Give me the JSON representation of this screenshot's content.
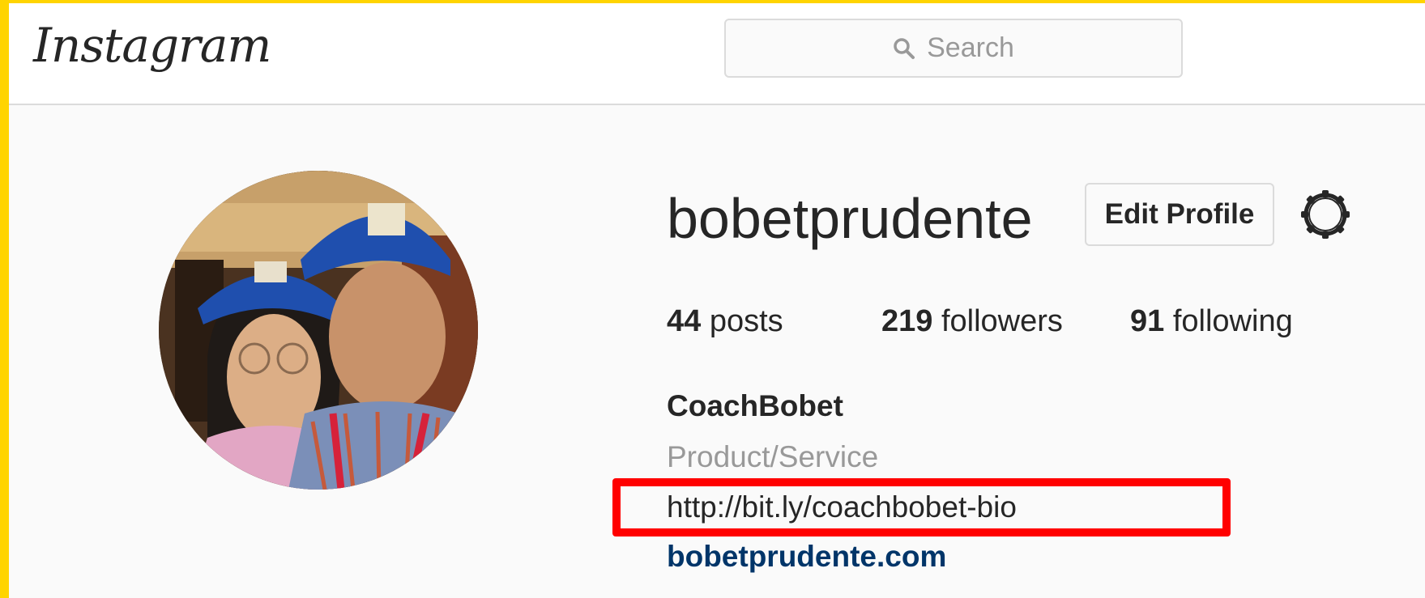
{
  "header": {
    "logo_text": "Instagram",
    "search_placeholder": "Search"
  },
  "profile": {
    "username": "bobetprudente",
    "edit_profile_label": "Edit Profile",
    "stats": {
      "posts_count": "44",
      "posts_label": "posts",
      "followers_count": "219",
      "followers_label": "followers",
      "following_count": "91",
      "following_label": "following"
    },
    "full_name": "CoachBobet",
    "category": "Product/Service",
    "bio_link": "http://bit.ly/coachbobet-bio",
    "website": "bobetprudente.com"
  },
  "icons": {
    "search": "search-icon",
    "settings": "gear-icon"
  },
  "colors": {
    "frame_border": "#ffd400",
    "highlight": "#ff0000",
    "link": "#003569",
    "muted_text": "#999999",
    "primary_text": "#262626"
  }
}
